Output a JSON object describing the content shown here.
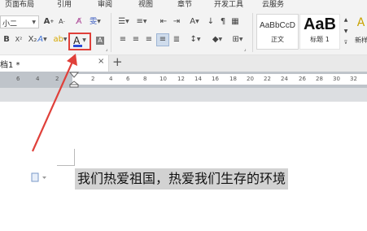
{
  "menu": [
    "页面布局",
    "引用",
    "审阅",
    "视图",
    "章节",
    "开发工具",
    "云服务"
  ],
  "ribbon": {
    "font_size": "小二",
    "font_color_letter": "A",
    "styles": [
      {
        "sample": "AaBbCcD",
        "name": "正文"
      },
      {
        "sample": "AaB",
        "name": "标题 1"
      }
    ],
    "new_style_label": "新样"
  },
  "document_tab": {
    "title": "档1 *",
    "close_symbol": "×",
    "add_symbol": "+"
  },
  "ruler": {
    "labels": [
      "6",
      "4",
      "2",
      "2",
      "4",
      "6",
      "8",
      "10",
      "12",
      "14",
      "16",
      "18",
      "20",
      "22",
      "24",
      "26",
      "28",
      "30",
      "32"
    ]
  },
  "document": {
    "text": "我们热爱祖国，热爱我们生存的环境"
  },
  "colors": {
    "annotation_red": "#e0403a",
    "font_color_underline": "#2b4ad6",
    "selection_gray": "#d2d2d2"
  }
}
